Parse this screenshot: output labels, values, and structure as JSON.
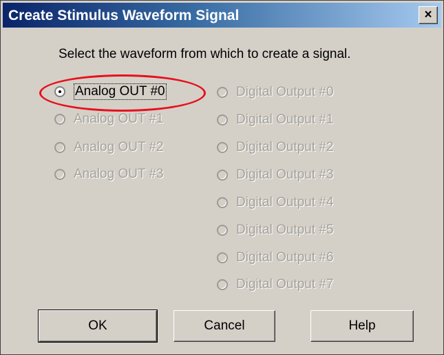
{
  "window": {
    "title": "Create Stimulus Waveform Signal",
    "close_label": "×"
  },
  "prompt": "Select the waveform from which to create a signal.",
  "analog_outputs": [
    {
      "label": "Analog OUT #0",
      "state": "selected",
      "enabled": true
    },
    {
      "label": "Analog OUT #1",
      "state": "unselected",
      "enabled": false
    },
    {
      "label": "Analog OUT #2",
      "state": "unselected",
      "enabled": false
    },
    {
      "label": "Analog OUT #3",
      "state": "unselected",
      "enabled": false
    }
  ],
  "digital_outputs": [
    {
      "label": "Digital Output #0",
      "enabled": false
    },
    {
      "label": "Digital Output #1",
      "enabled": false
    },
    {
      "label": "Digital Output #2",
      "enabled": false
    },
    {
      "label": "Digital Output #3",
      "enabled": false
    },
    {
      "label": "Digital Output #4",
      "enabled": false
    },
    {
      "label": "Digital Output #5",
      "enabled": false
    },
    {
      "label": "Digital Output #6",
      "enabled": false
    },
    {
      "label": "Digital Output #7",
      "enabled": false
    }
  ],
  "buttons": {
    "ok": "OK",
    "cancel": "Cancel",
    "help": "Help"
  },
  "colors": {
    "highlight_ring": "#e8101d",
    "title_bar": "#0a246a",
    "dialog_face": "#d4d0c8",
    "disabled_text": "#a5a29b"
  }
}
